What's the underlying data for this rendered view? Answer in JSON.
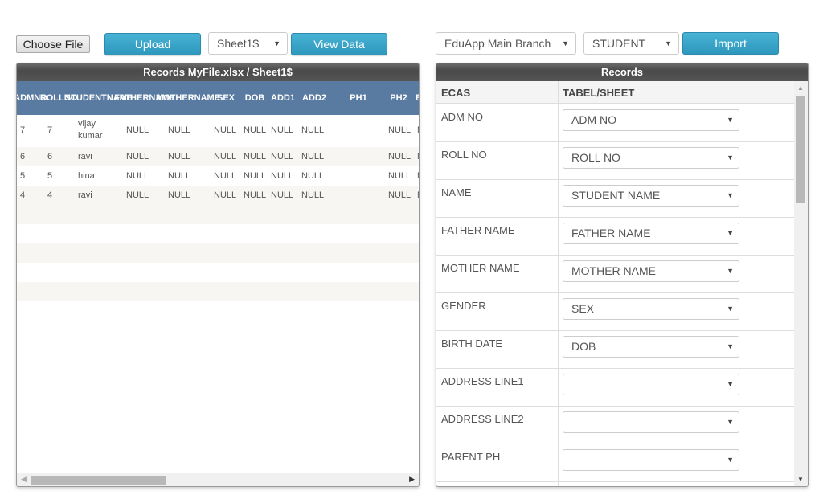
{
  "toolbar_left": {
    "choose_file_label": "Choose File",
    "upload_label": "Upload",
    "sheet_select": "Sheet1$",
    "view_data_label": "View Data"
  },
  "toolbar_right": {
    "branch_select": "EduApp Main Branch",
    "type_select": "STUDENT",
    "import_label": "Import"
  },
  "left_panel": {
    "title": "Records MyFile.xlsx / Sheet1$",
    "columns": [
      {
        "line1": "ADM",
        "line2": "NO"
      },
      {
        "line1": "ROLL",
        "line2": "NO"
      },
      {
        "line1": "STUDENT",
        "line2": "NAME"
      },
      {
        "line1": "FATHER",
        "line2": "NAME"
      },
      {
        "line1": "MOTHER",
        "line2": "NAME"
      },
      {
        "line1": "SEX",
        "line2": ""
      },
      {
        "line1": "DOB",
        "line2": ""
      },
      {
        "line1": "ADD1",
        "line2": ""
      },
      {
        "line1": "ADD2",
        "line2": ""
      },
      {
        "line1": "PH1",
        "line2": ""
      },
      {
        "line1": "PH2",
        "line2": ""
      },
      {
        "line1": "E",
        "line2": ""
      }
    ],
    "rows": [
      [
        "7",
        "7",
        "vijay kumar",
        "NULL",
        "NULL",
        "NULL",
        "NULL",
        "NULL",
        "NULL",
        "",
        "NULL",
        "N"
      ],
      [
        "6",
        "6",
        "ravi",
        "NULL",
        "NULL",
        "NULL",
        "NULL",
        "NULL",
        "NULL",
        "",
        "NULL",
        "N"
      ],
      [
        "5",
        "5",
        "hina",
        "NULL",
        "NULL",
        "NULL",
        "NULL",
        "NULL",
        "NULL",
        "",
        "NULL",
        "N"
      ],
      [
        "4",
        "4",
        "ravi",
        "NULL",
        "NULL",
        "NULL",
        "NULL",
        "NULL",
        "NULL",
        "",
        "NULL",
        "N"
      ]
    ]
  },
  "right_panel": {
    "title": "Records",
    "col_ecas": "ECAS",
    "col_sheet": "TABEL/SHEET",
    "mappings": [
      {
        "field": "ADM NO",
        "value": "ADM NO"
      },
      {
        "field": "ROLL NO",
        "value": "ROLL NO"
      },
      {
        "field": "NAME",
        "value": "STUDENT NAME"
      },
      {
        "field": "FATHER NAME",
        "value": "FATHER NAME"
      },
      {
        "field": "MOTHER NAME",
        "value": "MOTHER NAME"
      },
      {
        "field": "GENDER",
        "value": "SEX"
      },
      {
        "field": "BIRTH DATE",
        "value": "DOB"
      },
      {
        "field": "ADDRESS LINE1",
        "value": ""
      },
      {
        "field": "ADDRESS LINE2",
        "value": ""
      },
      {
        "field": "PARENT PH",
        "value": ""
      }
    ]
  },
  "icons": {
    "caret": "▼",
    "arrow_left": "◀",
    "arrow_right": "▶",
    "arrow_up": "▲",
    "arrow_down": "▼"
  }
}
